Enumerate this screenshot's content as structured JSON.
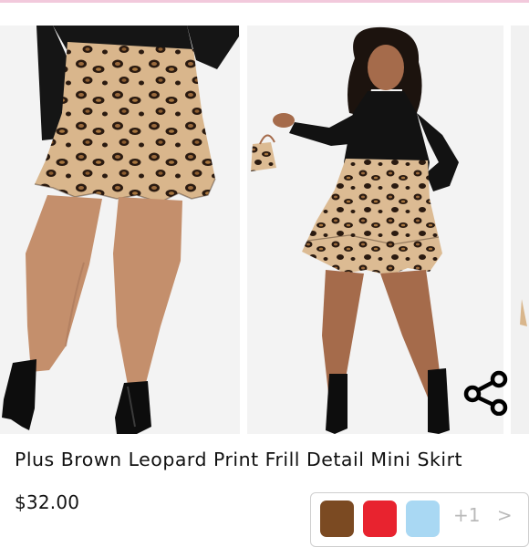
{
  "product": {
    "title": "Plus Brown Leopard Print Frill Detail Mini Skirt",
    "price": "$32.00"
  },
  "gallery": {
    "photos": [
      {
        "name": "product-photo-back"
      },
      {
        "name": "product-photo-front"
      },
      {
        "name": "product-photo-partial"
      }
    ]
  },
  "share_icon": "share-icon",
  "colors": {
    "swatches": [
      "#7b4a22",
      "#e8232f",
      "#a9d8f3"
    ],
    "more_label": "+1",
    "next_label": ">"
  },
  "accent": "#f2c9dc"
}
